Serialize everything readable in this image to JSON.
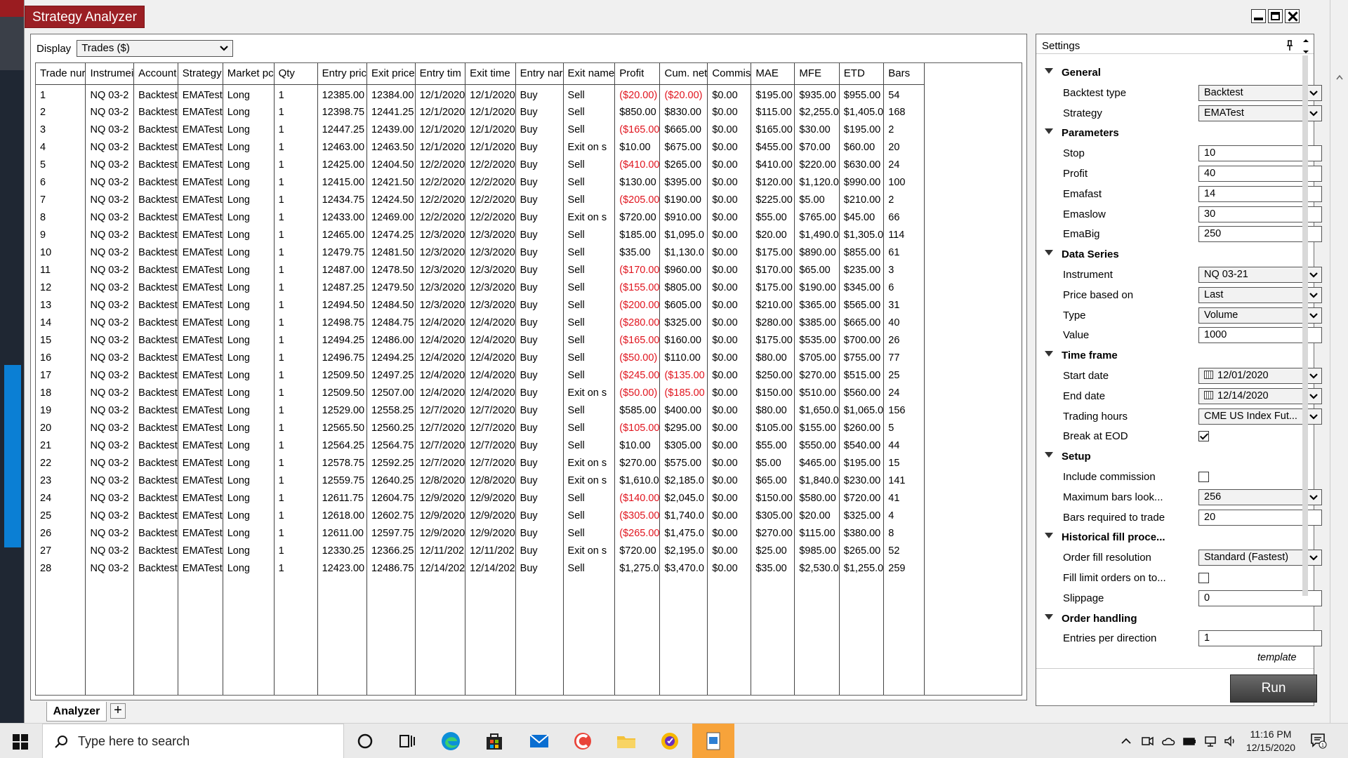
{
  "window": {
    "title": "Strategy Analyzer"
  },
  "display": {
    "label": "Display",
    "value": "Trades ($)"
  },
  "table": {
    "columns": [
      "Trade nur",
      "Instrumei",
      "Account",
      "Strategy",
      "Market pc",
      "Qty",
      "Entry pric",
      "Exit price",
      "Entry tim",
      "Exit time",
      "Entry nar",
      "Exit name",
      "Profit",
      "Cum. net",
      "Commis",
      "MAE",
      "MFE",
      "ETD",
      "Bars"
    ],
    "rows": [
      [
        "1",
        "NQ 03-2",
        "Backtest",
        "EMATest",
        "Long",
        "1",
        "12385.00",
        "12384.00",
        "12/1/2020",
        "12/1/2020",
        "Buy",
        "Sell",
        "($20.00)",
        "($20.00)",
        "$0.00",
        "$195.00",
        "$935.00",
        "$955.00",
        "54"
      ],
      [
        "2",
        "NQ 03-2",
        "Backtest",
        "EMATest",
        "Long",
        "1",
        "12398.75",
        "12441.25",
        "12/1/2020",
        "12/1/2020",
        "Buy",
        "Sell",
        "$850.00",
        "$830.00",
        "$0.00",
        "$115.00",
        "$2,255.0",
        "$1,405.0",
        "168"
      ],
      [
        "3",
        "NQ 03-2",
        "Backtest",
        "EMATest",
        "Long",
        "1",
        "12447.25",
        "12439.00",
        "12/1/2020",
        "12/1/2020",
        "Buy",
        "Sell",
        "($165.00",
        "$665.00",
        "$0.00",
        "$165.00",
        "$30.00",
        "$195.00",
        "2"
      ],
      [
        "4",
        "NQ 03-2",
        "Backtest",
        "EMATest",
        "Long",
        "1",
        "12463.00",
        "12463.50",
        "12/1/2020",
        "12/1/2020",
        "Buy",
        "Exit on s",
        "$10.00",
        "$675.00",
        "$0.00",
        "$455.00",
        "$70.00",
        "$60.00",
        "20"
      ],
      [
        "5",
        "NQ 03-2",
        "Backtest",
        "EMATest",
        "Long",
        "1",
        "12425.00",
        "12404.50",
        "12/2/2020",
        "12/2/2020",
        "Buy",
        "Sell",
        "($410.00",
        "$265.00",
        "$0.00",
        "$410.00",
        "$220.00",
        "$630.00",
        "24"
      ],
      [
        "6",
        "NQ 03-2",
        "Backtest",
        "EMATest",
        "Long",
        "1",
        "12415.00",
        "12421.50",
        "12/2/2020",
        "12/2/2020",
        "Buy",
        "Sell",
        "$130.00",
        "$395.00",
        "$0.00",
        "$120.00",
        "$1,120.0",
        "$990.00",
        "100"
      ],
      [
        "7",
        "NQ 03-2",
        "Backtest",
        "EMATest",
        "Long",
        "1",
        "12434.75",
        "12424.50",
        "12/2/2020",
        "12/2/2020",
        "Buy",
        "Sell",
        "($205.00",
        "$190.00",
        "$0.00",
        "$225.00",
        "$5.00",
        "$210.00",
        "2"
      ],
      [
        "8",
        "NQ 03-2",
        "Backtest",
        "EMATest",
        "Long",
        "1",
        "12433.00",
        "12469.00",
        "12/2/2020",
        "12/2/2020",
        "Buy",
        "Exit on s",
        "$720.00",
        "$910.00",
        "$0.00",
        "$55.00",
        "$765.00",
        "$45.00",
        "66"
      ],
      [
        "9",
        "NQ 03-2",
        "Backtest",
        "EMATest",
        "Long",
        "1",
        "12465.00",
        "12474.25",
        "12/3/2020",
        "12/3/2020",
        "Buy",
        "Sell",
        "$185.00",
        "$1,095.0",
        "$0.00",
        "$20.00",
        "$1,490.0",
        "$1,305.0",
        "114"
      ],
      [
        "10",
        "NQ 03-2",
        "Backtest",
        "EMATest",
        "Long",
        "1",
        "12479.75",
        "12481.50",
        "12/3/2020",
        "12/3/2020",
        "Buy",
        "Sell",
        "$35.00",
        "$1,130.0",
        "$0.00",
        "$175.00",
        "$890.00",
        "$855.00",
        "61"
      ],
      [
        "11",
        "NQ 03-2",
        "Backtest",
        "EMATest",
        "Long",
        "1",
        "12487.00",
        "12478.50",
        "12/3/2020",
        "12/3/2020",
        "Buy",
        "Sell",
        "($170.00",
        "$960.00",
        "$0.00",
        "$170.00",
        "$65.00",
        "$235.00",
        "3"
      ],
      [
        "12",
        "NQ 03-2",
        "Backtest",
        "EMATest",
        "Long",
        "1",
        "12487.25",
        "12479.50",
        "12/3/2020",
        "12/3/2020",
        "Buy",
        "Sell",
        "($155.00",
        "$805.00",
        "$0.00",
        "$175.00",
        "$190.00",
        "$345.00",
        "6"
      ],
      [
        "13",
        "NQ 03-2",
        "Backtest",
        "EMATest",
        "Long",
        "1",
        "12494.50",
        "12484.50",
        "12/3/2020",
        "12/3/2020",
        "Buy",
        "Sell",
        "($200.00",
        "$605.00",
        "$0.00",
        "$210.00",
        "$365.00",
        "$565.00",
        "31"
      ],
      [
        "14",
        "NQ 03-2",
        "Backtest",
        "EMATest",
        "Long",
        "1",
        "12498.75",
        "12484.75",
        "12/4/2020",
        "12/4/2020",
        "Buy",
        "Sell",
        "($280.00",
        "$325.00",
        "$0.00",
        "$280.00",
        "$385.00",
        "$665.00",
        "40"
      ],
      [
        "15",
        "NQ 03-2",
        "Backtest",
        "EMATest",
        "Long",
        "1",
        "12494.25",
        "12486.00",
        "12/4/2020",
        "12/4/2020",
        "Buy",
        "Sell",
        "($165.00",
        "$160.00",
        "$0.00",
        "$175.00",
        "$535.00",
        "$700.00",
        "26"
      ],
      [
        "16",
        "NQ 03-2",
        "Backtest",
        "EMATest",
        "Long",
        "1",
        "12496.75",
        "12494.25",
        "12/4/2020",
        "12/4/2020",
        "Buy",
        "Sell",
        "($50.00)",
        "$110.00",
        "$0.00",
        "$80.00",
        "$705.00",
        "$755.00",
        "77"
      ],
      [
        "17",
        "NQ 03-2",
        "Backtest",
        "EMATest",
        "Long",
        "1",
        "12509.50",
        "12497.25",
        "12/4/2020",
        "12/4/2020",
        "Buy",
        "Sell",
        "($245.00",
        "($135.00",
        "$0.00",
        "$250.00",
        "$270.00",
        "$515.00",
        "25"
      ],
      [
        "18",
        "NQ 03-2",
        "Backtest",
        "EMATest",
        "Long",
        "1",
        "12509.50",
        "12507.00",
        "12/4/2020",
        "12/4/2020",
        "Buy",
        "Exit on s",
        "($50.00)",
        "($185.00",
        "$0.00",
        "$150.00",
        "$510.00",
        "$560.00",
        "24"
      ],
      [
        "19",
        "NQ 03-2",
        "Backtest",
        "EMATest",
        "Long",
        "1",
        "12529.00",
        "12558.25",
        "12/7/2020",
        "12/7/2020",
        "Buy",
        "Sell",
        "$585.00",
        "$400.00",
        "$0.00",
        "$80.00",
        "$1,650.0",
        "$1,065.0",
        "156"
      ],
      [
        "20",
        "NQ 03-2",
        "Backtest",
        "EMATest",
        "Long",
        "1",
        "12565.50",
        "12560.25",
        "12/7/2020",
        "12/7/2020",
        "Buy",
        "Sell",
        "($105.00",
        "$295.00",
        "$0.00",
        "$105.00",
        "$155.00",
        "$260.00",
        "5"
      ],
      [
        "21",
        "NQ 03-2",
        "Backtest",
        "EMATest",
        "Long",
        "1",
        "12564.25",
        "12564.75",
        "12/7/2020",
        "12/7/2020",
        "Buy",
        "Sell",
        "$10.00",
        "$305.00",
        "$0.00",
        "$55.00",
        "$550.00",
        "$540.00",
        "44"
      ],
      [
        "22",
        "NQ 03-2",
        "Backtest",
        "EMATest",
        "Long",
        "1",
        "12578.75",
        "12592.25",
        "12/7/2020",
        "12/7/2020",
        "Buy",
        "Exit on s",
        "$270.00",
        "$575.00",
        "$0.00",
        "$5.00",
        "$465.00",
        "$195.00",
        "15"
      ],
      [
        "23",
        "NQ 03-2",
        "Backtest",
        "EMATest",
        "Long",
        "1",
        "12559.75",
        "12640.25",
        "12/8/2020",
        "12/8/2020",
        "Buy",
        "Exit on s",
        "$1,610.0",
        "$2,185.0",
        "$0.00",
        "$65.00",
        "$1,840.0",
        "$230.00",
        "141"
      ],
      [
        "24",
        "NQ 03-2",
        "Backtest",
        "EMATest",
        "Long",
        "1",
        "12611.75",
        "12604.75",
        "12/9/2020",
        "12/9/2020",
        "Buy",
        "Sell",
        "($140.00",
        "$2,045.0",
        "$0.00",
        "$150.00",
        "$580.00",
        "$720.00",
        "41"
      ],
      [
        "25",
        "NQ 03-2",
        "Backtest",
        "EMATest",
        "Long",
        "1",
        "12618.00",
        "12602.75",
        "12/9/2020",
        "12/9/2020",
        "Buy",
        "Sell",
        "($305.00",
        "$1,740.0",
        "$0.00",
        "$305.00",
        "$20.00",
        "$325.00",
        "4"
      ],
      [
        "26",
        "NQ 03-2",
        "Backtest",
        "EMATest",
        "Long",
        "1",
        "12611.00",
        "12597.75",
        "12/9/2020",
        "12/9/2020",
        "Buy",
        "Sell",
        "($265.00",
        "$1,475.0",
        "$0.00",
        "$270.00",
        "$115.00",
        "$380.00",
        "8"
      ],
      [
        "27",
        "NQ 03-2",
        "Backtest",
        "EMATest",
        "Long",
        "1",
        "12330.25",
        "12366.25",
        "12/11/202",
        "12/11/202",
        "Buy",
        "Exit on s",
        "$720.00",
        "$2,195.0",
        "$0.00",
        "$25.00",
        "$985.00",
        "$265.00",
        "52"
      ],
      [
        "28",
        "NQ 03-2",
        "Backtest",
        "EMATest",
        "Long",
        "1",
        "12423.00",
        "12486.75",
        "12/14/202",
        "12/14/202",
        "Buy",
        "Sell",
        "$1,275.0",
        "$3,470.0",
        "$0.00",
        "$35.00",
        "$2,530.0",
        "$1,255.0",
        "259"
      ]
    ]
  },
  "settings": {
    "title": "Settings",
    "template_link": "template",
    "run_label": "Run",
    "rows": [
      {
        "kind": "cat",
        "label": "General"
      },
      {
        "kind": "select",
        "label": "Backtest type",
        "value": "Backtest"
      },
      {
        "kind": "select",
        "label": "Strategy",
        "value": "EMATest"
      },
      {
        "kind": "cat",
        "label": "Parameters"
      },
      {
        "kind": "input",
        "label": "Stop",
        "value": "10"
      },
      {
        "kind": "input",
        "label": "Profit",
        "value": "40"
      },
      {
        "kind": "input",
        "label": "Emafast",
        "value": "14"
      },
      {
        "kind": "input",
        "label": "Emaslow",
        "value": "30"
      },
      {
        "kind": "input",
        "label": "EmaBig",
        "value": "250"
      },
      {
        "kind": "cat",
        "label": "Data Series"
      },
      {
        "kind": "select",
        "label": "Instrument",
        "value": "NQ 03-21"
      },
      {
        "kind": "select",
        "label": "Price based on",
        "value": "Last"
      },
      {
        "kind": "select",
        "label": "Type",
        "value": "Volume"
      },
      {
        "kind": "input",
        "label": "Value",
        "value": "1000"
      },
      {
        "kind": "cat",
        "label": "Time frame"
      },
      {
        "kind": "date",
        "label": "Start date",
        "value": "12/01/2020"
      },
      {
        "kind": "date",
        "label": "End date",
        "value": "12/14/2020"
      },
      {
        "kind": "select",
        "label": "Trading hours",
        "value": "CME US Index Fut..."
      },
      {
        "kind": "check",
        "label": "Break at EOD",
        "checked": true
      },
      {
        "kind": "cat",
        "label": "Setup"
      },
      {
        "kind": "check",
        "label": "Include commission",
        "checked": false
      },
      {
        "kind": "select",
        "label": "Maximum bars look...",
        "value": "256"
      },
      {
        "kind": "input",
        "label": "Bars required to trade",
        "value": "20"
      },
      {
        "kind": "cat",
        "label": "Historical fill proce..."
      },
      {
        "kind": "select",
        "label": "Order fill resolution",
        "value": "Standard (Fastest)"
      },
      {
        "kind": "check",
        "label": "Fill limit orders on to...",
        "checked": false
      },
      {
        "kind": "input",
        "label": "Slippage",
        "value": "0"
      },
      {
        "kind": "cat",
        "label": "Order handling"
      },
      {
        "kind": "input",
        "label": "Entries per direction",
        "value": "1"
      }
    ]
  },
  "tabs": {
    "analyzer": "Analyzer",
    "add": "+"
  },
  "taskbar": {
    "search_placeholder": "Type here to search",
    "time": "11:16 PM",
    "date": "12/15/2020",
    "notification_count": "1"
  },
  "colors": {
    "title_tab": "#9b1f24",
    "negative": "#e0141e",
    "run_button": "#4a4a4a",
    "taskbar_active": "#f7a33a"
  }
}
